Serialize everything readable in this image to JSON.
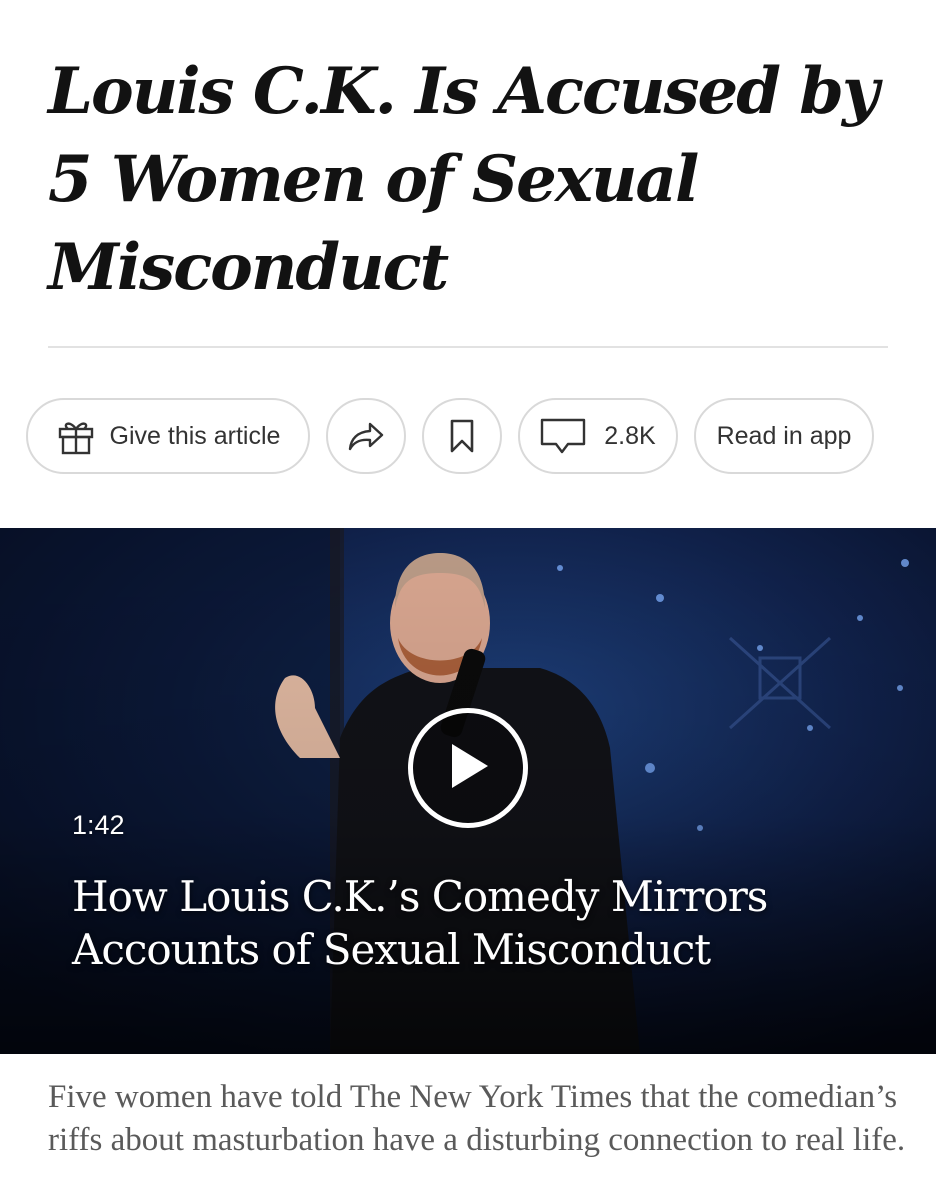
{
  "article": {
    "headline": "Louis C.K. Is Accused by 5 Women of Sexual Misconduct",
    "summary": "Five women have told The New York Times that the comedian’s riffs about masturbation have a disturbing connection to real life."
  },
  "toolbar": {
    "gift_label": "Give this article",
    "comment_count": "2.8K",
    "read_in_app_label": "Read in app",
    "icons": [
      "gift-icon",
      "share-icon",
      "bookmark-icon",
      "comment-icon"
    ]
  },
  "video": {
    "duration": "1:42",
    "title": "How Louis C.K.’s Comedy Mirrors Accounts of Sexual Misconduct",
    "icons": [
      "play-icon"
    ]
  },
  "colors": {
    "text": "#121212",
    "summary_text": "#5a5a5a",
    "pill_border": "#d9d9d9",
    "divider": "#e2e2e2",
    "video_background": "#0b1230"
  }
}
